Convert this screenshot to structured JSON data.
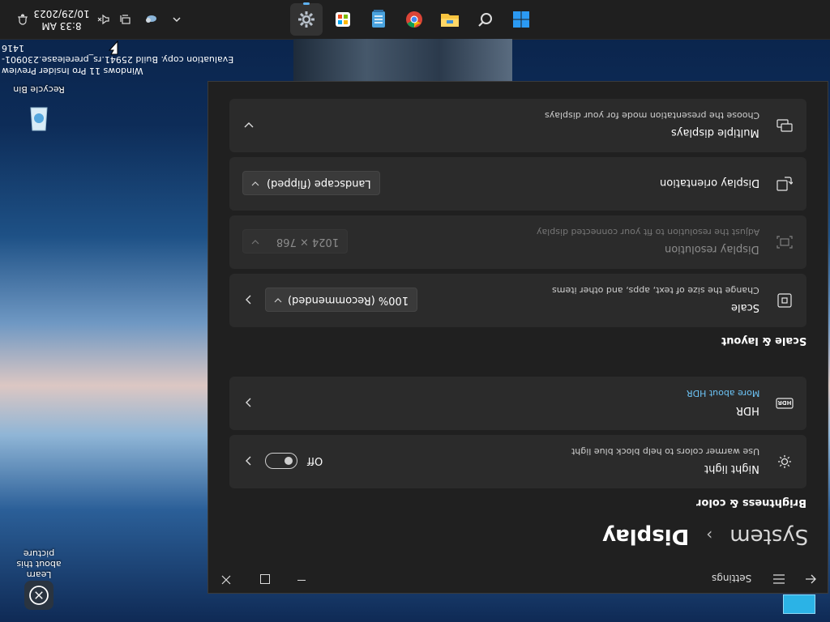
{
  "taskbar": {
    "clock": {
      "time": "8:33 AM",
      "date": "10/29/2023"
    },
    "apps": [
      {
        "name": "settings",
        "active": true
      },
      {
        "name": "microsoft-store"
      },
      {
        "name": "notepad"
      },
      {
        "name": "chrome"
      },
      {
        "name": "file-explorer"
      },
      {
        "name": "search"
      },
      {
        "name": "start"
      }
    ]
  },
  "watermark": {
    "line1": "Evaluation copy. Build 25941.rs_prerelease.230901-1416",
    "line2": "Windows 11 Pro Insider Preview"
  },
  "desktop": {
    "recycle_bin": "Recycle Bin",
    "learn_about": "Learn about this picture"
  },
  "settings": {
    "app_title": "Settings",
    "breadcrumb": {
      "parent": "System",
      "sep": "›",
      "current": "Display"
    },
    "sections": {
      "brightness": "Brightness & color",
      "scale": "Scale & layout"
    },
    "night_light": {
      "title": "Night light",
      "subtitle": "Use warmer colors to help block blue light",
      "toggle_label": "Off",
      "enabled": false
    },
    "hdr": {
      "title": "HDR",
      "link": "More about HDR"
    },
    "scale": {
      "title": "Scale",
      "subtitle": "Change the size of text, apps, and other items",
      "value": "100% (Recommended)"
    },
    "resolution": {
      "title": "Display resolution",
      "subtitle": "Adjust the resolution to fit your connected display",
      "value": "1024 × 768"
    },
    "orientation": {
      "title": "Display orientation",
      "value": "Landscape (flipped)"
    },
    "multiple": {
      "title": "Multiple displays",
      "subtitle": "Choose the presentation mode for your displays"
    },
    "colors": {
      "accent": "#5fb2f2",
      "window_bg": "#202020",
      "card_bg": "#2b2b2b"
    }
  }
}
